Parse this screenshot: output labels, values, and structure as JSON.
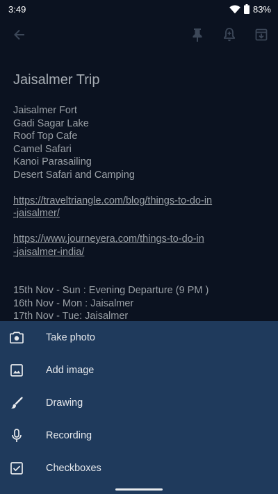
{
  "status_bar": {
    "time": "3:49",
    "battery": "83%",
    "icons": [
      "wifi-icon",
      "battery-icon"
    ]
  },
  "toolbar": {
    "icons": [
      "back-arrow-icon",
      "pin-icon",
      "reminder-bell-icon",
      "archive-icon"
    ]
  },
  "note": {
    "title": "Jaisalmer Trip",
    "places": [
      "Jaisalmer Fort",
      "Gadi Sagar Lake",
      "Roof Top Cafe",
      "Camel Safari",
      "Kanoi Parasailing",
      "Desert Safari and Camping"
    ],
    "link1": {
      "line1": "https://traveltriangle.com/blog/things-to-do-in",
      "line2": "-jaisalmer/"
    },
    "link2": {
      "line1": "https://www.journeyera.com/things-to-do-in",
      "line2": "-jaisalmer-india/"
    },
    "schedule": [
      "15th  Nov - Sun : Evening Departure (9 PM )",
      "16th Nov - Mon : Jaisalmer",
      "17th Nov - Tue:  Jaisalmer"
    ]
  },
  "bottom_sheet": {
    "items": [
      {
        "label": "Take photo",
        "icon": "camera-icon"
      },
      {
        "label": "Add image",
        "icon": "image-icon"
      },
      {
        "label": "Drawing",
        "icon": "brush-icon"
      },
      {
        "label": "Recording",
        "icon": "microphone-icon"
      },
      {
        "label": "Checkboxes",
        "icon": "checkbox-icon"
      }
    ]
  },
  "colors": {
    "background": "#0b1220",
    "sheet": "#1f3a5c",
    "note_text": "#9aa0a6"
  }
}
